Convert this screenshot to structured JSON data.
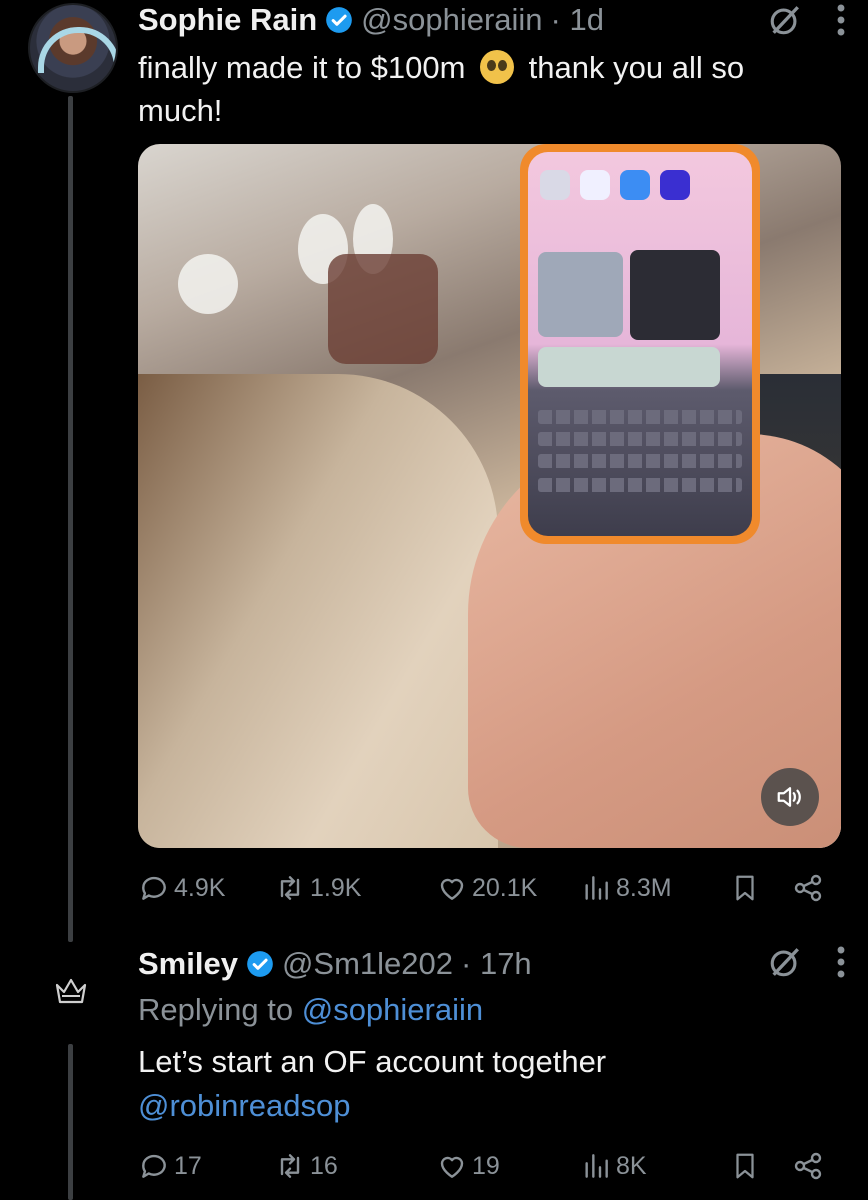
{
  "tweet": {
    "author_name": "Sophie Rain",
    "handle": "@sophieraiin",
    "time": "· 1d",
    "text_before": "finally made it to $100m",
    "text_after": "thank you all so much!",
    "emoji": "pleading-face",
    "media_sound_icon": "speaker-icon",
    "stats": {
      "replies": "4.9K",
      "reposts": "1.9K",
      "likes": "20.1K",
      "views": "8.3M"
    }
  },
  "reply": {
    "author_name": "Smiley",
    "handle": "@Sm1le202",
    "time": "· 17h",
    "replying_label": "Replying to",
    "replying_handle": "@sophieraiin",
    "text": "Let’s start an OF account together",
    "mention": "@robinreadsop",
    "stats": {
      "replies": "17",
      "reposts": "16",
      "likes": "19",
      "views": "8K"
    }
  },
  "colors": {
    "background": "#000000",
    "secondary_text": "#8b9298",
    "link": "#4e8fd6",
    "verified": "#1d9bf0"
  }
}
